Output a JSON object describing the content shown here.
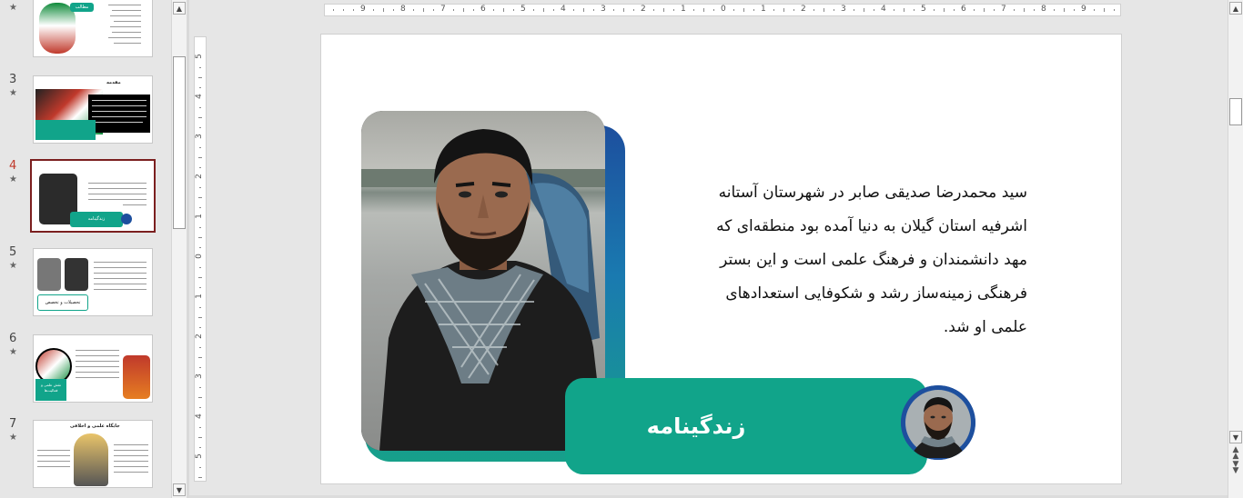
{
  "thumbnails": [
    {
      "number": "",
      "title": "مطالب"
    },
    {
      "number": "3",
      "title": "مقدمه"
    },
    {
      "number": "4",
      "title": "زندگینامه"
    },
    {
      "number": "5",
      "title": "تحصیلات و تخصص"
    },
    {
      "number": "6",
      "title": "نقش علمی و فعالیت‌ها"
    },
    {
      "number": "7",
      "title": "جایگاه علمی و اخلاقی"
    }
  ],
  "ruler": {
    "horizontal": [
      "9",
      "8",
      "7",
      "6",
      "5",
      "4",
      "3",
      "2",
      "1",
      "0",
      "1",
      "2",
      "3",
      "4",
      "5",
      "6",
      "7",
      "8",
      "9"
    ],
    "vertical": [
      "5",
      "4",
      "3",
      "2",
      "1",
      "0",
      "1",
      "2",
      "3",
      "4",
      "5"
    ]
  },
  "slide": {
    "bio_lines": [
      "سید محمدرضا صدیقی صابر در شهرستان آستانه",
      "اشرفیه استان گیلان به دنیا آمده بود منطقه‌ای که",
      "مهد دانشمندان و فرهنگ علمی است و این بستر",
      "فرهنگی زمینه‌ساز رشد و شکوفایی استعدادهای",
      "علمی او شد."
    ],
    "title": "زندگینامه"
  },
  "colors": {
    "accent": "#11a48a",
    "frame_blue": "#1d4f9e",
    "selected_border": "#7b1f1f"
  }
}
